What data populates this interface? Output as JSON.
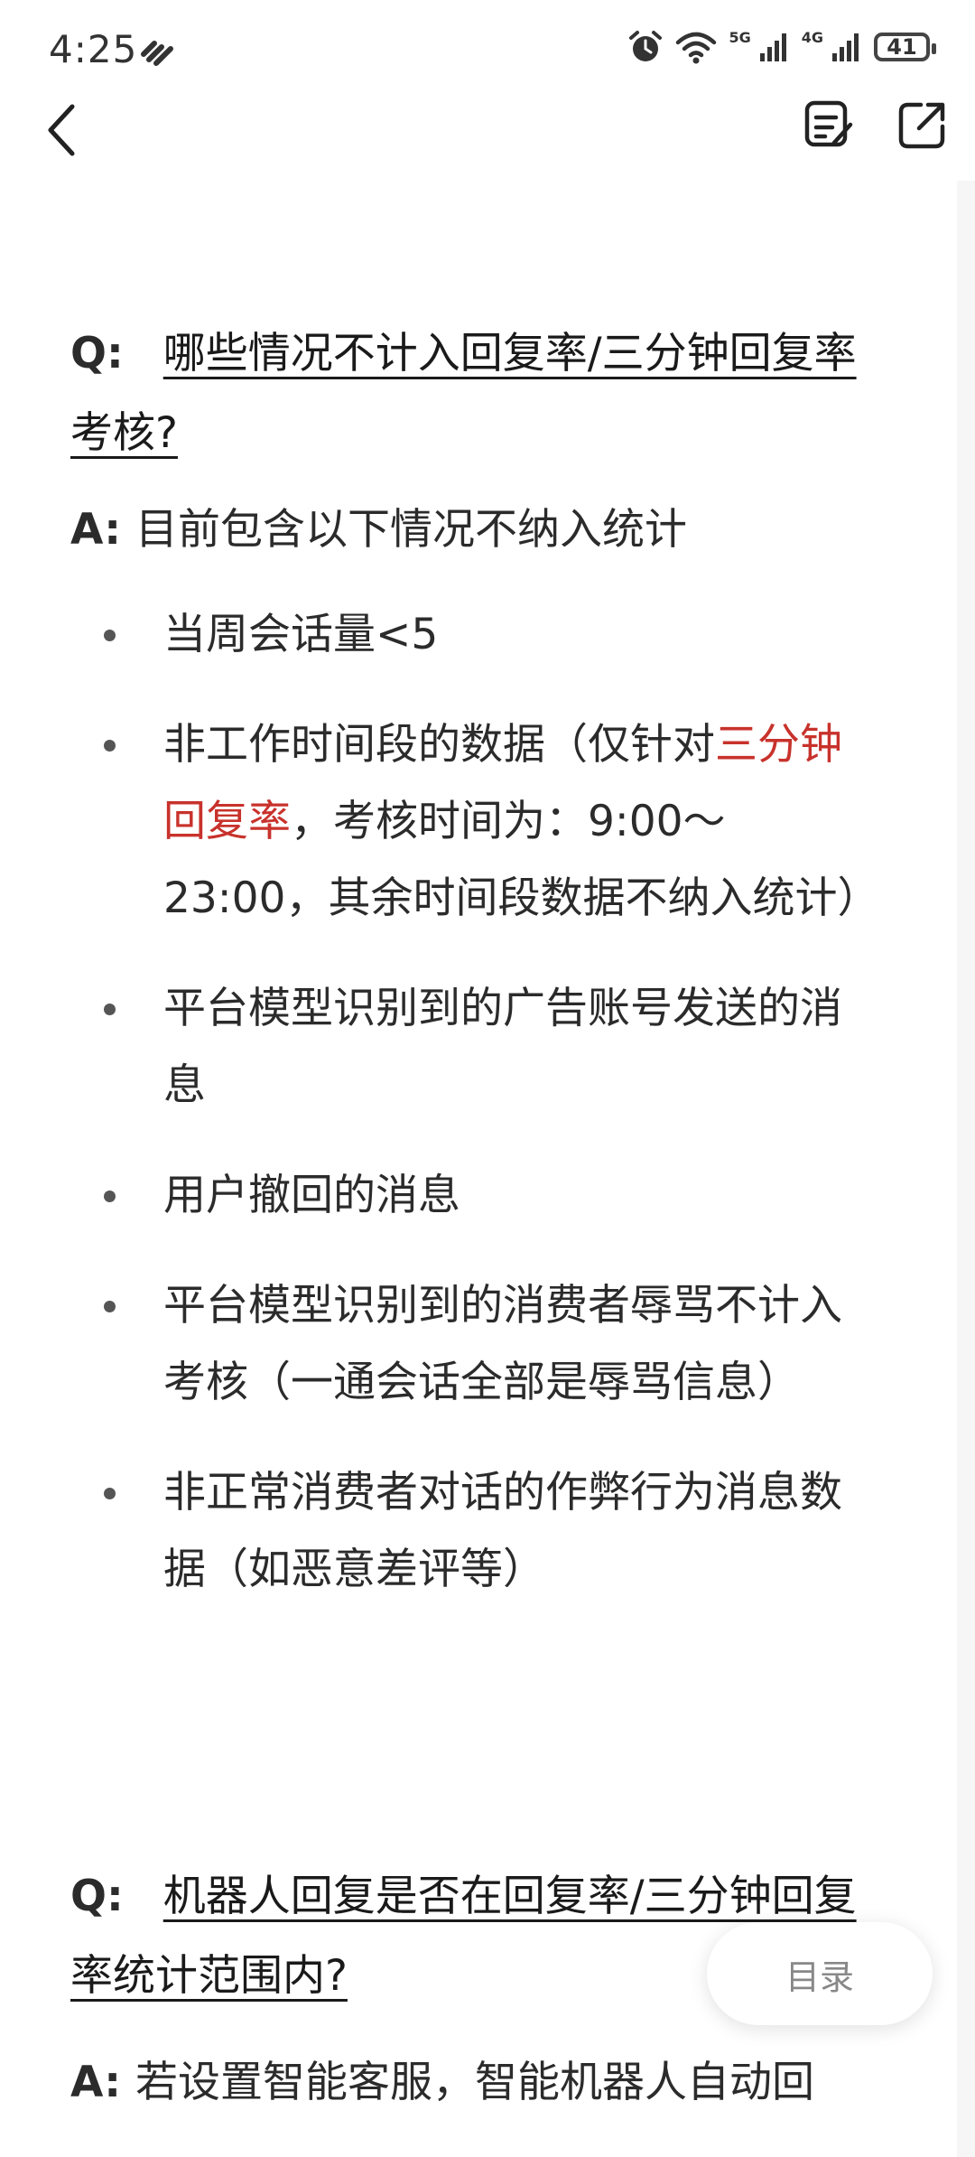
{
  "status_bar": {
    "time": "4:25",
    "battery": "41",
    "network_labels": [
      "5G",
      "4G"
    ],
    "icons": [
      "signal-app-icon",
      "alarm-icon",
      "wifi-icon",
      "cellular-5g-icon",
      "cellular-4g-icon",
      "battery-icon"
    ]
  },
  "nav": {
    "icons": [
      "back-icon",
      "notes-edit-icon",
      "share-icon"
    ]
  },
  "faq1": {
    "q_label": "Q:",
    "question": "哪些情况不计入回复率/三分钟回复率考核?",
    "a_label": "A:",
    "answer_intro": "目前包含以下情况不纳入统计",
    "bullets": {
      "b1": "当周会话量<5",
      "b2_pre": "非工作时间段的数据（仅针对",
      "b2_red": "三分钟回复率",
      "b2_post": "，考核时间为：9:00～23:00，其余时间段数据不纳入统计）",
      "b3": "平台模型识别到的广告账号发送的消息",
      "b4": "用户撤回的消息",
      "b5": "平台模型识别到的消费者辱骂不计入考核（一通会话全部是辱骂信息）",
      "b6": "非正常消费者对话的作弊行为消息数据（如恶意差评等）"
    }
  },
  "faq2": {
    "q_label": "Q:",
    "question": "机器人回复是否在回复率/三分钟回复率统计范围内?",
    "a_label": "A:",
    "answer": "若设置智能客服，智能机器人自动回"
  },
  "toc_button": "目录",
  "colors": {
    "highlight": "#c8322c",
    "text": "#2b2b2b"
  }
}
